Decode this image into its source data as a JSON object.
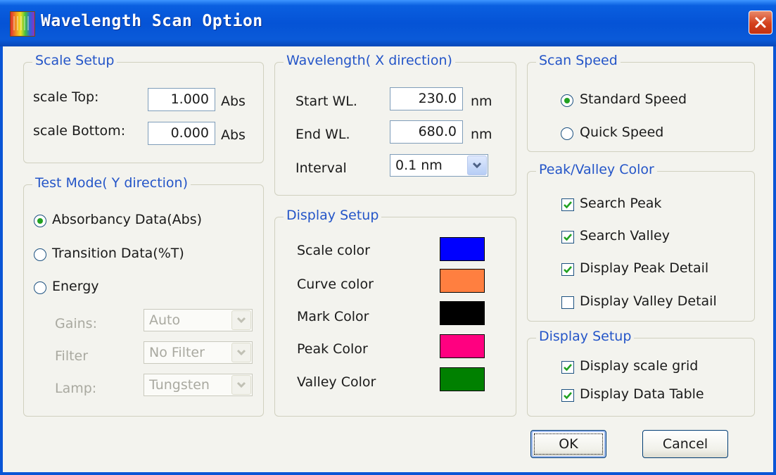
{
  "window": {
    "title": "Wavelength Scan Option"
  },
  "scale_setup": {
    "legend": "Scale Setup",
    "top_label": "scale Top:",
    "top_value": "1.000",
    "top_unit": "Abs",
    "bottom_label": "scale Bottom:",
    "bottom_value": "0.000",
    "bottom_unit": "Abs"
  },
  "test_mode": {
    "legend": "Test Mode( Y direction)",
    "options": [
      "Absorbancy Data(Abs)",
      "Transition Data(%T)",
      "Energy"
    ],
    "selected": "Absorbancy Data(Abs)",
    "gains_label": "Gains:",
    "gains_value": "Auto",
    "filter_label": "Filter",
    "filter_value": "No Filter",
    "lamp_label": "Lamp:",
    "lamp_value": "Tungsten"
  },
  "wavelength": {
    "legend": "Wavelength( X direction)",
    "start_label": "Start WL.",
    "start_value": "230.0",
    "start_unit": "nm",
    "end_label": "End WL.",
    "end_value": "680.0",
    "end_unit": "nm",
    "interval_label": "Interval",
    "interval_value": "0.1 nm"
  },
  "display_colors": {
    "legend": "Display Setup",
    "items": [
      {
        "label": "Scale color",
        "color": "#0000ff"
      },
      {
        "label": "Curve color",
        "color": "#ff7f40"
      },
      {
        "label": "Mark Color",
        "color": "#000000"
      },
      {
        "label": "Peak Color",
        "color": "#ff0080"
      },
      {
        "label": "Valley Color",
        "color": "#008000"
      }
    ]
  },
  "scan_speed": {
    "legend": "Scan Speed",
    "options": [
      "Standard Speed",
      "Quick Speed"
    ],
    "selected": "Standard Speed"
  },
  "peak_valley": {
    "legend": "Peak/Valley Color",
    "items": [
      {
        "label": "Search Peak",
        "checked": true
      },
      {
        "label": "Search Valley",
        "checked": true
      },
      {
        "label": "Display Peak Detail",
        "checked": true
      },
      {
        "label": "Display Valley Detail",
        "checked": false
      }
    ]
  },
  "display_setup2": {
    "legend": "Display Setup",
    "items": [
      {
        "label": "Display scale grid",
        "checked": true
      },
      {
        "label": "Display Data Table",
        "checked": true
      }
    ]
  },
  "buttons": {
    "ok": "OK",
    "cancel": "Cancel"
  },
  "icons": {
    "app": "spectrum-icon",
    "close": "close-icon",
    "dropdown": "chevron-down-icon",
    "check": "checkmark-icon"
  },
  "colors": {
    "titlebar": "#0553d6",
    "legend_text": "#2455c8",
    "close_button": "#d4401c",
    "radio_dot": "#21a121",
    "checkmark": "#21a121"
  }
}
